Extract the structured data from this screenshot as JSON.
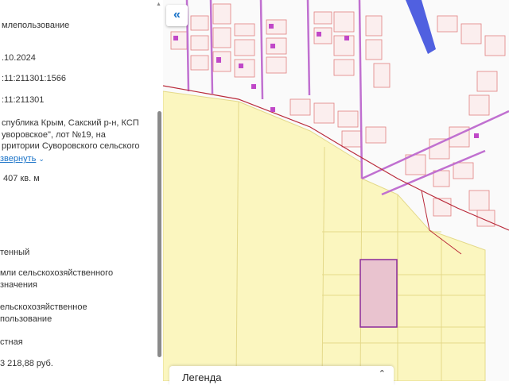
{
  "sidebar": {
    "lines": [
      "млепользование",
      ".10.2024",
      ":11:211301:1566",
      ":11:211301",
      "спублика Крым, Сакский р-н, КСП",
      "уворовское\", лот №19, на",
      "рритории Суворовского сельского",
      "407 кв. м",
      "тенный",
      "мли сельскохозяйственного",
      "значения",
      "ельскохозяйственное",
      "пользование",
      "стная",
      "3 218,88 руб."
    ],
    "expand_label": "звернуть",
    "chevron_icon": "chevron-down-icon"
  },
  "map": {
    "collapse_label": "«",
    "legend_title": "Легенда",
    "legend_toggle": "˄\n˅",
    "colors": {
      "field": "#fbf6bf",
      "parcel_stroke": "#e08080",
      "selected_fill": "#e9c3cf",
      "selected_stroke": "#8b2a9a",
      "road": "#b92a3a",
      "zone": "#c070d0",
      "building": "#c048c8",
      "blue_block": "#5060e0"
    }
  }
}
